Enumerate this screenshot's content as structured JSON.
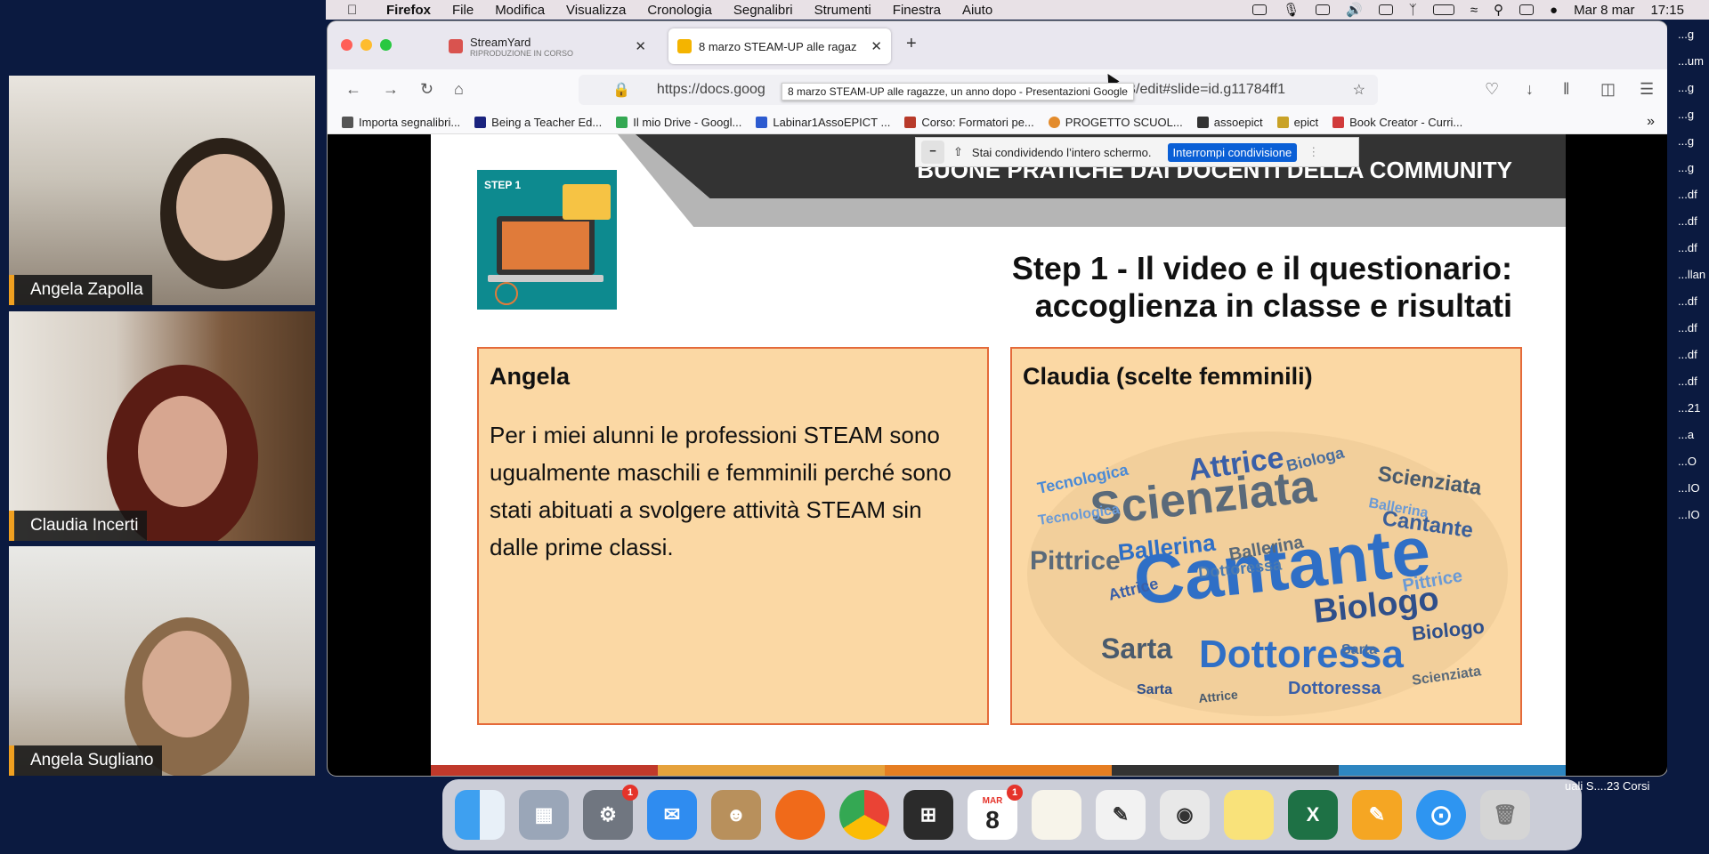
{
  "participants": [
    {
      "name": "Angela Zapolla"
    },
    {
      "name": "Claudia Incerti"
    },
    {
      "name": "Angela Sugliano"
    }
  ],
  "menubar": {
    "app": "Firefox",
    "items": [
      "File",
      "Modifica",
      "Visualizza",
      "Cronologia",
      "Segnalibri",
      "Strumenti",
      "Finestra",
      "Aiuto"
    ],
    "datetime": "Mar 8 mar",
    "time": "17:15"
  },
  "tabs": [
    {
      "title": "StreamYard",
      "subtitle": "RIPRODUZIONE IN CORSO"
    },
    {
      "title": "8 marzo STEAM-UP alle ragaz"
    }
  ],
  "url": {
    "display": "https://docs.goog",
    "tail": "laeB/edit#slide=id.g11784ff1"
  },
  "tooltip": "8 marzo STEAM-UP alle ragazze, un anno dopo - Presentazioni Google",
  "bookmarks": [
    "Importa segnalibri...",
    "Being a Teacher Ed...",
    "Il mio Drive - Googl...",
    "Labinar1AssoEPICT ...",
    "Corso: Formatori pe...",
    "PROGETTO SCUOL...",
    "assoepict",
    "epict",
    "Book Creator - Curri..."
  ],
  "sharebar": {
    "text": "Stai condividendo l’intero schermo.",
    "stop": "Interrompi condivisione"
  },
  "slide": {
    "banner": "BUONE PRATICHE DAI DOCENTI DELLA COMMUNITY",
    "step_label": "STEP 1",
    "title_line1": "Step 1 - Il video e il questionario:",
    "title_line2": "accoglienza in classe e risultati",
    "card1": {
      "title": "Angela",
      "text": "Per i miei alunni le professioni STEAM sono ugualmente maschili e femminili perché sono stati abituati a svolgere attività STEAM sin dalle prime classi."
    },
    "card2": {
      "title": "Claudia (scelte femminili)"
    },
    "wordcloud": [
      "Cantante",
      "Scienziata",
      "Dottoressa",
      "Biologo",
      "Sarta",
      "Attrice",
      "Pittrice",
      "Ballerina",
      "Tecnologica",
      "Cantante",
      "Biologa",
      "Scienziata",
      "Dottoressa",
      "Attrice",
      "Ballerina",
      "Sarta",
      "Pittrice",
      "Biologo",
      "Tecnologica",
      "Dottoressa",
      "Scienziata",
      "Sarta",
      "Ballerina",
      "Attrice"
    ]
  },
  "right_sidebar": [
    "...g",
    "...um",
    "...g",
    "...g",
    "...g",
    "...g",
    "...df",
    "...df",
    "...df",
    "...llan",
    "...df",
    "...df",
    "...df",
    "...df",
    "...21",
    "...a",
    "...O",
    "...IO",
    "...IO"
  ],
  "dock_label": "uali  S....23  Corsi",
  "calendar": {
    "month": "MAR",
    "day": "8"
  },
  "badge_count": "1"
}
